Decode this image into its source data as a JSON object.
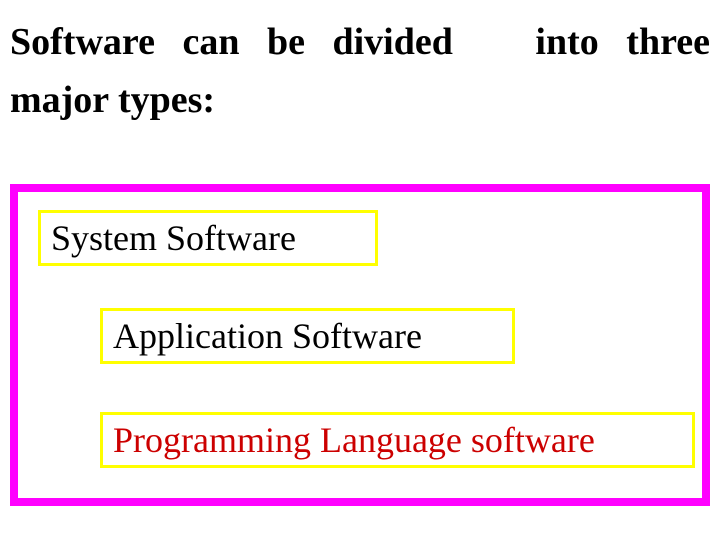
{
  "heading": {
    "line1_part1": "Software",
    "line1_part2": "can",
    "line1_part3": "be",
    "line1_part4": "divided",
    "line1_part5": "into",
    "line1_part6": "three",
    "line2": "major types:"
  },
  "boxes": {
    "item1": "System Software",
    "item2": "Application Software",
    "item3": "Programming Language software"
  },
  "colors": {
    "outer_border": "#ff00ff",
    "inner_border": "#ffff00",
    "accent_text": "#cc0000"
  }
}
